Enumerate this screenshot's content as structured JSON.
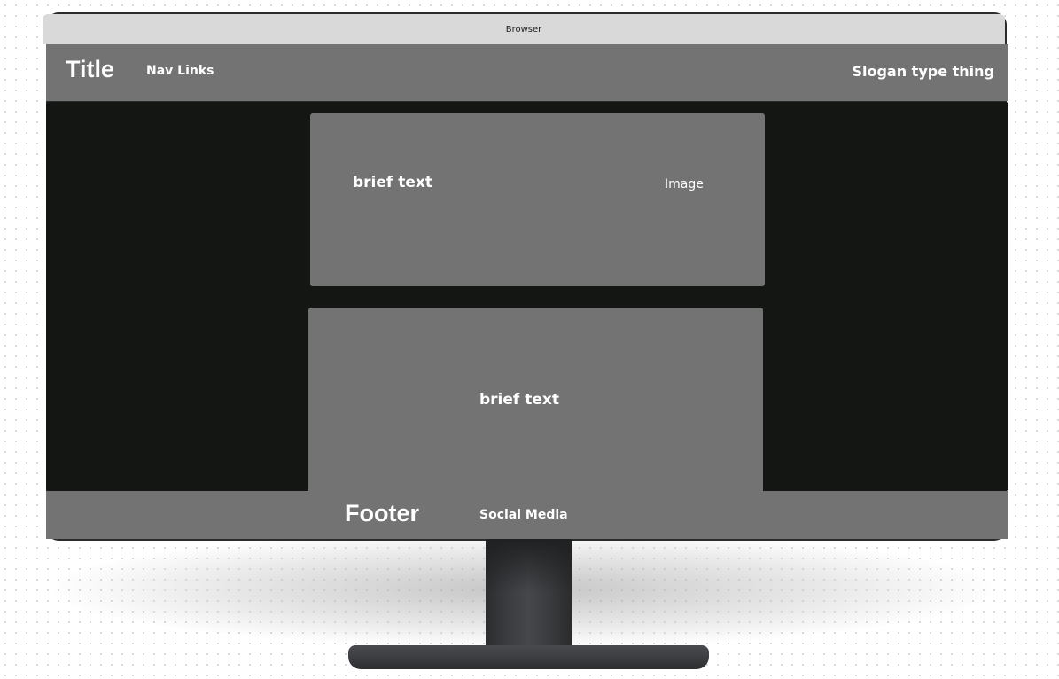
{
  "browser": {
    "title": "Browser"
  },
  "header": {
    "title": "Title",
    "nav_label": "Nav Links",
    "slogan": "Slogan type thing"
  },
  "main": {
    "card_1": {
      "text": "brief text",
      "image_label": "Image"
    },
    "card_2": {
      "text": "brief text"
    }
  },
  "footer": {
    "title": "Footer",
    "social_label": "Social Media"
  },
  "colors": {
    "panel_gray": "#737373",
    "content_background": "#141614",
    "browser_bar": "#d9d9d9",
    "text": "#ffffff"
  }
}
